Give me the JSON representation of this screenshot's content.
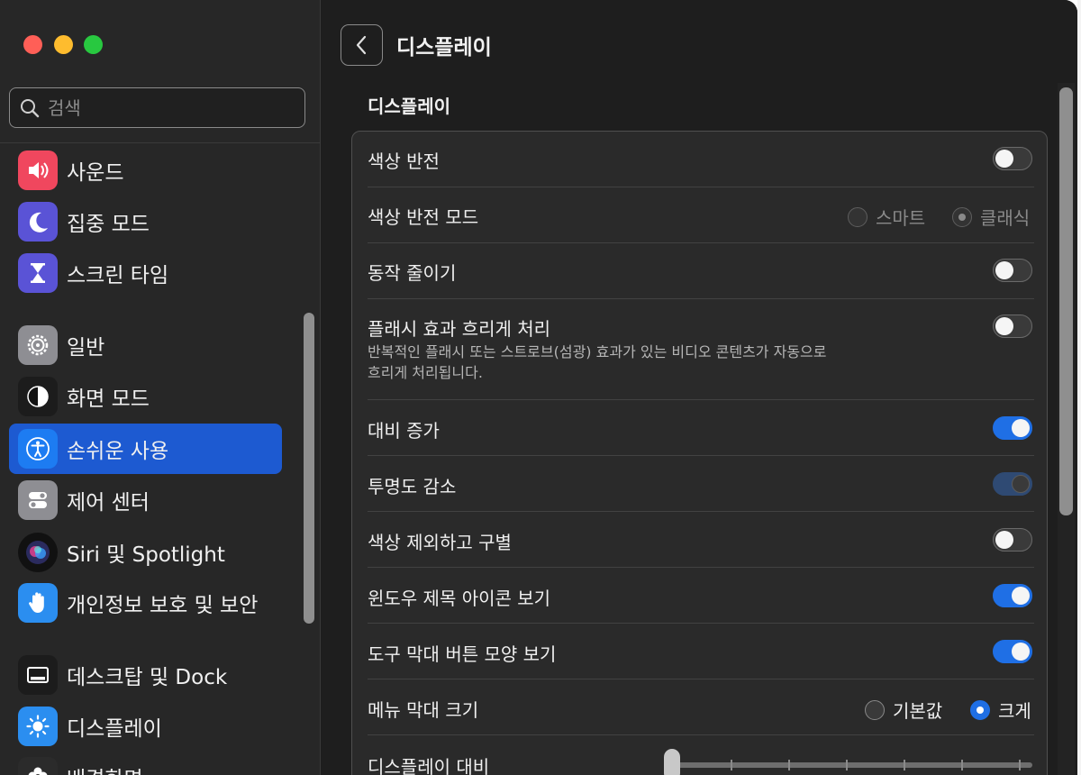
{
  "window": {
    "traffic_lights": {
      "close": "#ff5f57",
      "minimize": "#febc2e",
      "zoom": "#28c840"
    }
  },
  "sidebar": {
    "search": {
      "placeholder": "검색",
      "value": ""
    },
    "items": [
      {
        "label": "사운드",
        "icon": "speaker-icon",
        "color": "#f0475e"
      },
      {
        "label": "집중 모드",
        "icon": "moon-icon",
        "color": "#5a53d6"
      },
      {
        "label": "스크린 타임",
        "icon": "hourglass-icon",
        "color": "#5a53d6"
      },
      {
        "label": "일반",
        "icon": "gear-icon",
        "color": "#8e8e93"
      },
      {
        "label": "화면 모드",
        "icon": "appearance-icon",
        "color": "#1c1c1c"
      },
      {
        "label": "손쉬운 사용",
        "icon": "accessibility-icon",
        "color": "#1d7cf2",
        "selected": true
      },
      {
        "label": "제어 센터",
        "icon": "control-center-icon",
        "color": "#8e8e93"
      },
      {
        "label": "Siri 및 Spotlight",
        "icon": "siri-icon",
        "color": "#2b2b5e"
      },
      {
        "label": "개인정보 보호 및 보안",
        "icon": "hand-icon",
        "color": "#2b8ef0"
      },
      {
        "label": "데스크탑 및 Dock",
        "icon": "dock-icon",
        "color": "#1c1c1c"
      },
      {
        "label": "디스플레이",
        "icon": "brightness-icon",
        "color": "#2b8ef0"
      },
      {
        "label": "배경화면",
        "icon": "flower-icon",
        "color": "#2b2b2b"
      }
    ]
  },
  "header": {
    "title": "디스플레이"
  },
  "section": {
    "title": "디스플레이"
  },
  "settings": {
    "invert_colors": {
      "label": "색상 반전",
      "on": false
    },
    "invert_mode": {
      "label": "색상 반전 모드",
      "options": [
        "스마트",
        "클래식"
      ],
      "selected": "클래식",
      "enabled": false
    },
    "reduce_motion": {
      "label": "동작 줄이기",
      "on": false
    },
    "dim_flashing": {
      "label": "플래시 효과 흐리게 처리",
      "description_line1": "반복적인 플래시 또는 스트로브(섬광) 효과가 있는 비디오 콘텐츠가 자동으로",
      "description_line2": "흐리게 처리됩니다.",
      "on": false
    },
    "increase_contrast": {
      "label": "대비 증가",
      "on": true
    },
    "reduce_transparency": {
      "label": "투명도 감소",
      "on": true,
      "enabled": false
    },
    "differentiate_without_color": {
      "label": "색상 제외하고 구별",
      "on": false
    },
    "show_window_title_icons": {
      "label": "윈도우 제목 아이콘 보기",
      "on": true
    },
    "show_toolbar_button_shapes": {
      "label": "도구 막대 버튼 모양 보기",
      "on": true
    },
    "menu_bar_size": {
      "label": "메뉴 막대 크기",
      "options": [
        "기본값",
        "크게"
      ],
      "selected": "크게"
    },
    "display_contrast": {
      "label": "디스플레이 대비",
      "value": 0
    }
  },
  "accent_color": "#1f6fe5"
}
